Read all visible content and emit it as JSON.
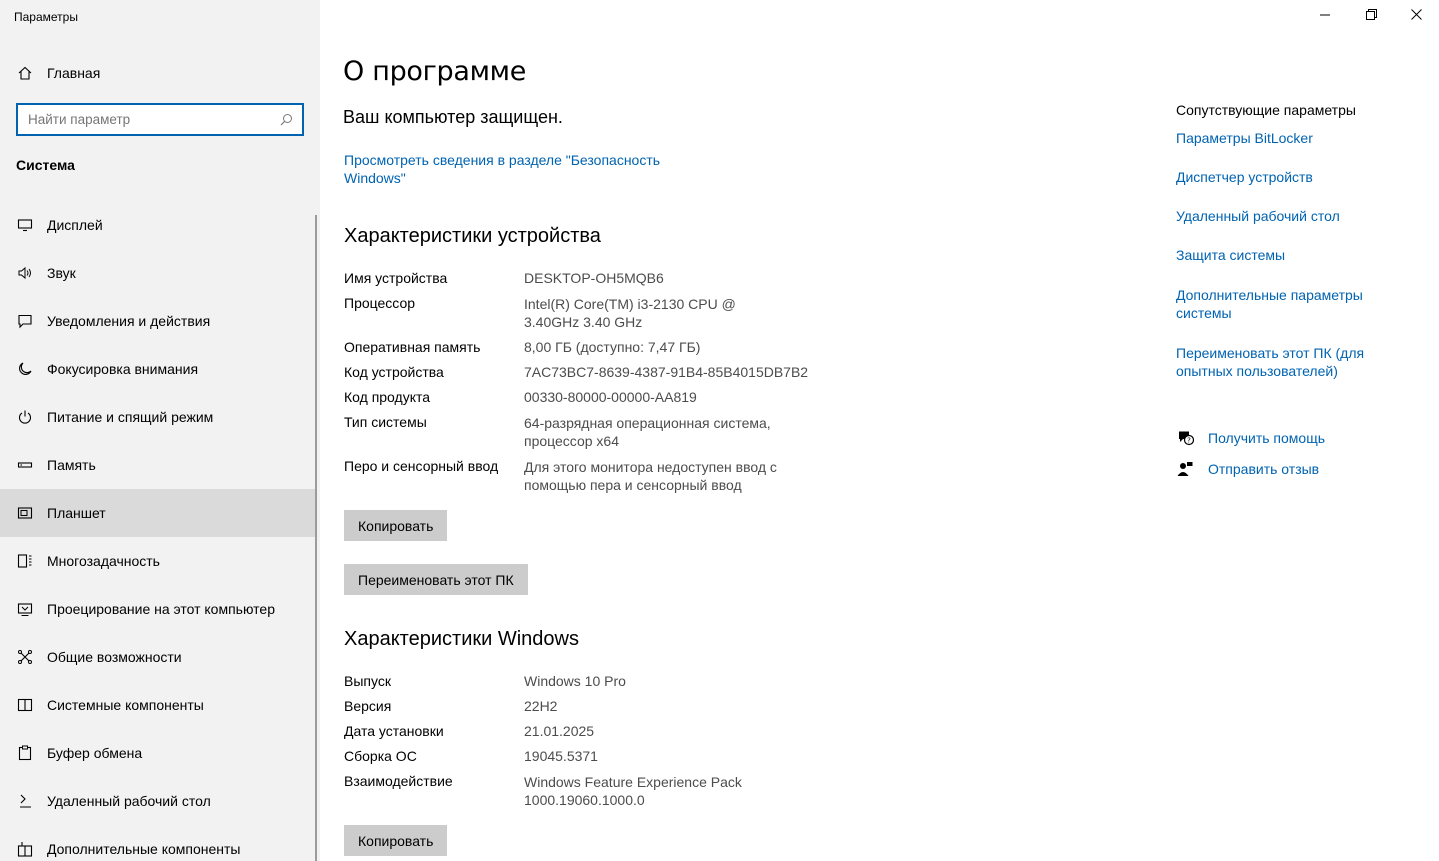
{
  "window": {
    "title": "Параметры"
  },
  "sidebar": {
    "home_label": "Главная",
    "search_placeholder": "Найти параметр",
    "section_title": "Система",
    "items": [
      {
        "label": "Дисплей",
        "icon": "display-icon"
      },
      {
        "label": "Звук",
        "icon": "speaker-icon"
      },
      {
        "label": "Уведомления и действия",
        "icon": "notification-icon"
      },
      {
        "label": "Фокусировка внимания",
        "icon": "moon-icon"
      },
      {
        "label": "Питание и спящий режим",
        "icon": "power-icon"
      },
      {
        "label": "Память",
        "icon": "storage-icon"
      },
      {
        "label": "Планшет",
        "icon": "tablet-icon",
        "selected": true
      },
      {
        "label": "Многозадачность",
        "icon": "multitasking-icon"
      },
      {
        "label": "Проецирование на этот компьютер",
        "icon": "projecting-icon"
      },
      {
        "label": "Общие возможности",
        "icon": "shared-experiences-icon"
      },
      {
        "label": "Системные компоненты",
        "icon": "system-components-icon"
      },
      {
        "label": "Буфер обмена",
        "icon": "clipboard-icon"
      },
      {
        "label": "Удаленный рабочий стол",
        "icon": "remote-desktop-icon"
      },
      {
        "label": "Дополнительные компоненты",
        "icon": "optional-features-icon"
      }
    ]
  },
  "main": {
    "title": "О программе",
    "protected_text": "Ваш компьютер защищен.",
    "security_link": "Просмотреть сведения в разделе \"Безопасность Windows\"",
    "device_specs": {
      "heading": "Характеристики устройства",
      "rows": [
        {
          "label": "Имя устройства",
          "value": "DESKTOP-OH5MQB6"
        },
        {
          "label": "Процессор",
          "value": "Intel(R) Core(TM) i3-2130 CPU @ 3.40GHz 3.40 GHz"
        },
        {
          "label": "Оперативная память",
          "value": "8,00 ГБ (доступно: 7,47 ГБ)"
        },
        {
          "label": "Код устройства",
          "value": "7AC73BC7-8639-4387-91B4-85B4015DB7B2"
        },
        {
          "label": "Код продукта",
          "value": "00330-80000-00000-AA819"
        },
        {
          "label": "Тип системы",
          "value": "64-разрядная операционная система, процессор x64"
        },
        {
          "label": "Перо и сенсорный ввод",
          "value": "Для этого монитора недоступен ввод с помощью пера и сенсорный ввод"
        }
      ],
      "copy_button": "Копировать",
      "rename_button": "Переименовать этот ПК"
    },
    "windows_specs": {
      "heading": "Характеристики Windows",
      "rows": [
        {
          "label": "Выпуск",
          "value": "Windows 10 Pro"
        },
        {
          "label": "Версия",
          "value": "22H2"
        },
        {
          "label": "Дата установки",
          "value": "21.01.2025"
        },
        {
          "label": "Сборка ОС",
          "value": "19045.5371"
        },
        {
          "label": "Взаимодействие",
          "value": "Windows Feature Experience Pack 1000.19060.1000.0"
        }
      ],
      "copy_button": "Копировать"
    }
  },
  "related": {
    "title": "Сопутствующие параметры",
    "links": [
      "Параметры BitLocker",
      "Диспетчер устройств",
      "Удаленный рабочий стол",
      "Защита системы",
      "Дополнительные параметры системы",
      "Переименовать этот ПК (для опытных пользователей)"
    ],
    "help_label": "Получить помощь",
    "feedback_label": "Отправить отзыв"
  },
  "colors": {
    "accent": "#0063b1",
    "sidebar_bg": "#f2f2f2",
    "selected_bg": "#dadada",
    "button_bg": "#cccccc"
  }
}
